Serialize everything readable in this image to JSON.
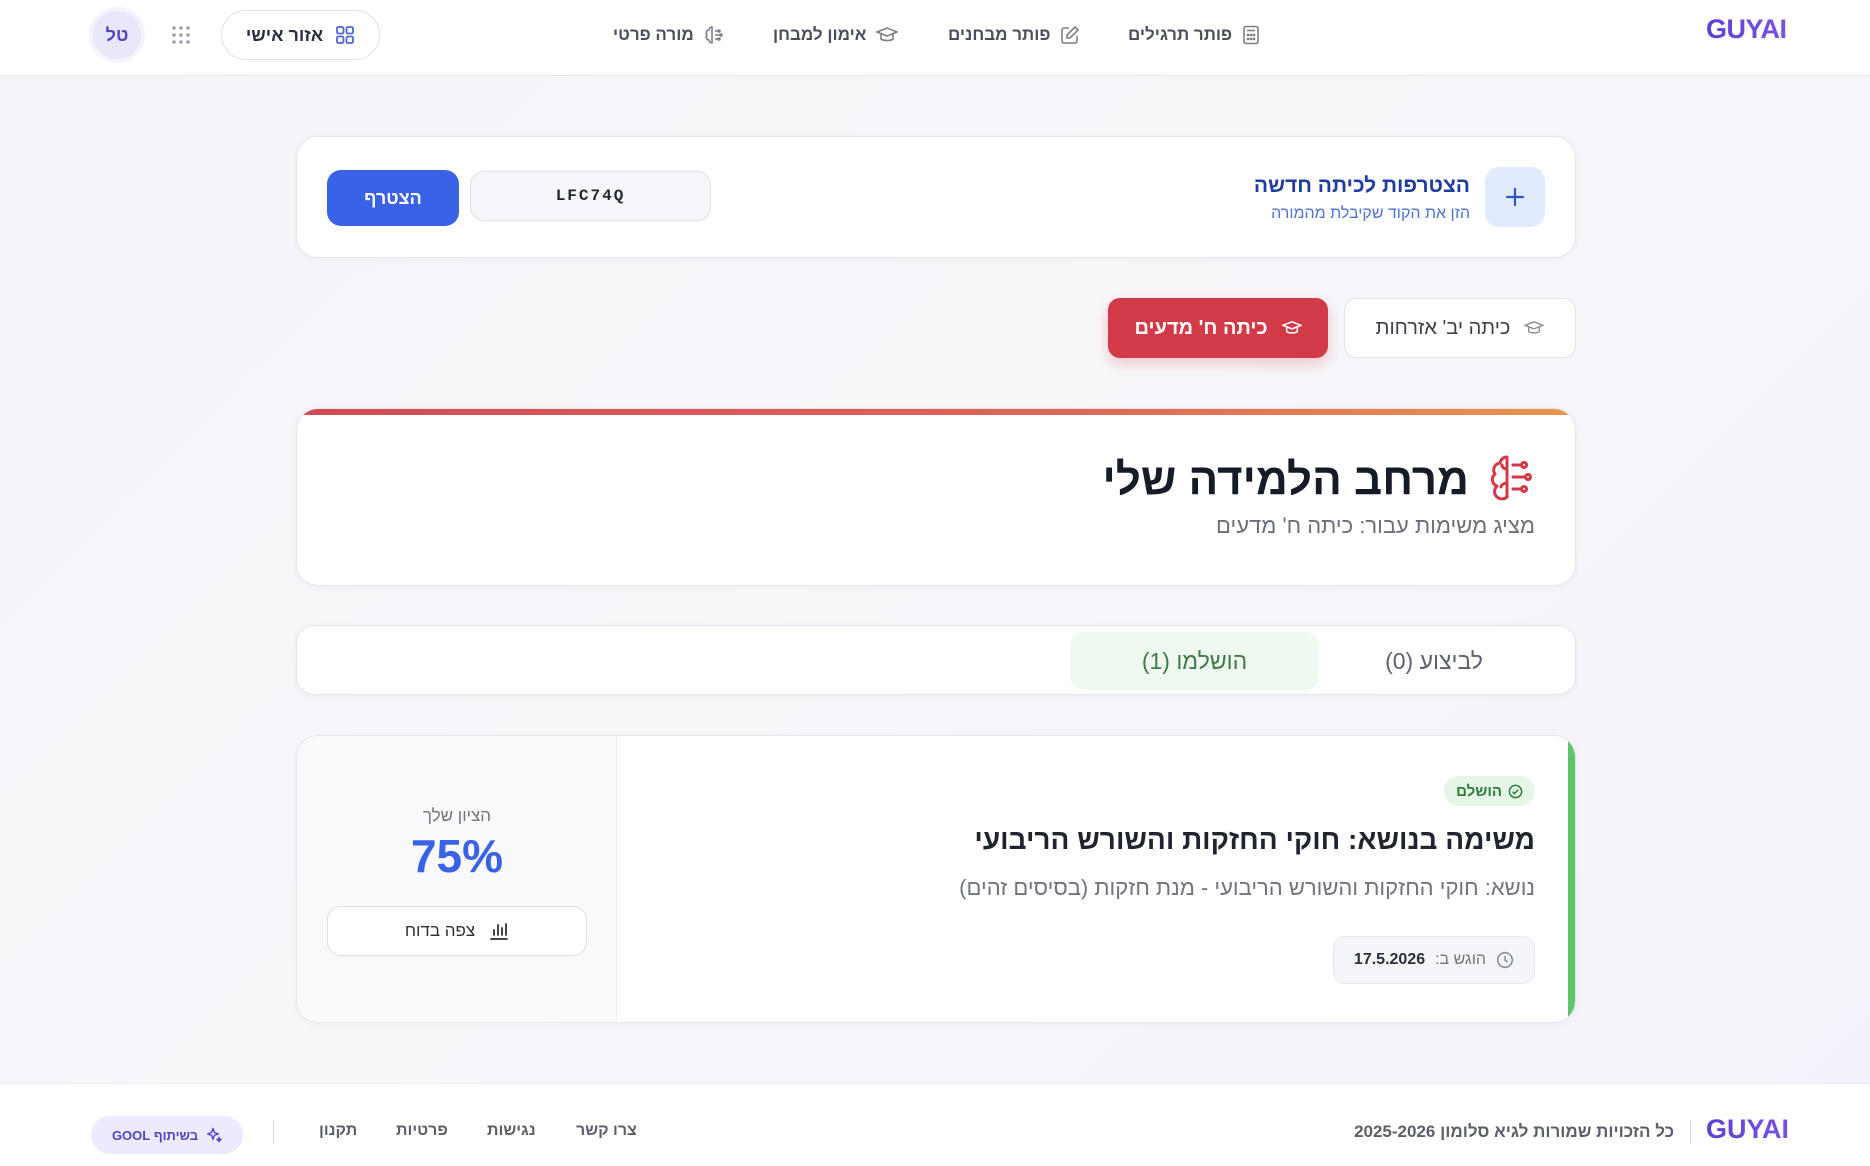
{
  "header": {
    "logo": "GUYAI",
    "avatar_initials": "טל",
    "personal_area_label": "אזור אישי",
    "nav": [
      {
        "label": "פותר תרגילים",
        "icon": "calculator-icon"
      },
      {
        "label": "פותר מבחנים",
        "icon": "pencil-square-icon"
      },
      {
        "label": "אימון למבחן",
        "icon": "graduation-cap-icon"
      },
      {
        "label": "מורה פרטי",
        "icon": "brain-icon"
      }
    ]
  },
  "join": {
    "title": "הצטרפות לכיתה חדשה",
    "subtitle": "הזן את הקוד שקיבלת מהמורה",
    "code_value": "LFC74Q",
    "button_label": "הצטרף"
  },
  "classes": [
    {
      "label": "כיתה יב' אזרחות",
      "active": false
    },
    {
      "label": "כיתה ח' מדעים",
      "active": true
    }
  ],
  "space": {
    "title": "מרחב הלמידה שלי",
    "subtitle": "מציג משימות עבור: כיתה ח' מדעים"
  },
  "tabs": {
    "todo_label": "לביצוע (0)",
    "done_label": "הושלמו (1)"
  },
  "assignment": {
    "status": "הושלם",
    "title": "משימה בנושא: חוקי החזקות והשורש הריבועי",
    "topic": "נושא: חוקי החזקות והשורש הריבועי - מנת חזקות (בסיסים זהים)",
    "submitted_label": "הוגש ב:",
    "submitted_date": "17.5.2026",
    "grade_label": "הציון שלך",
    "grade_value": "75%",
    "view_button": "צפה בדוח"
  },
  "footer": {
    "logo": "GUYAI",
    "copyright": "כל הזכויות שמורות לגיא סלומון 2025-2026",
    "links": [
      "צרו קשר",
      "נגישות",
      "פרטיות",
      "תקנון"
    ],
    "partner": "בשיתוף GOOL"
  },
  "colors": {
    "primary": "#3a62e6",
    "active_class": "#d23a48",
    "success": "#5fc46b",
    "brand": "#5b3fd6"
  }
}
